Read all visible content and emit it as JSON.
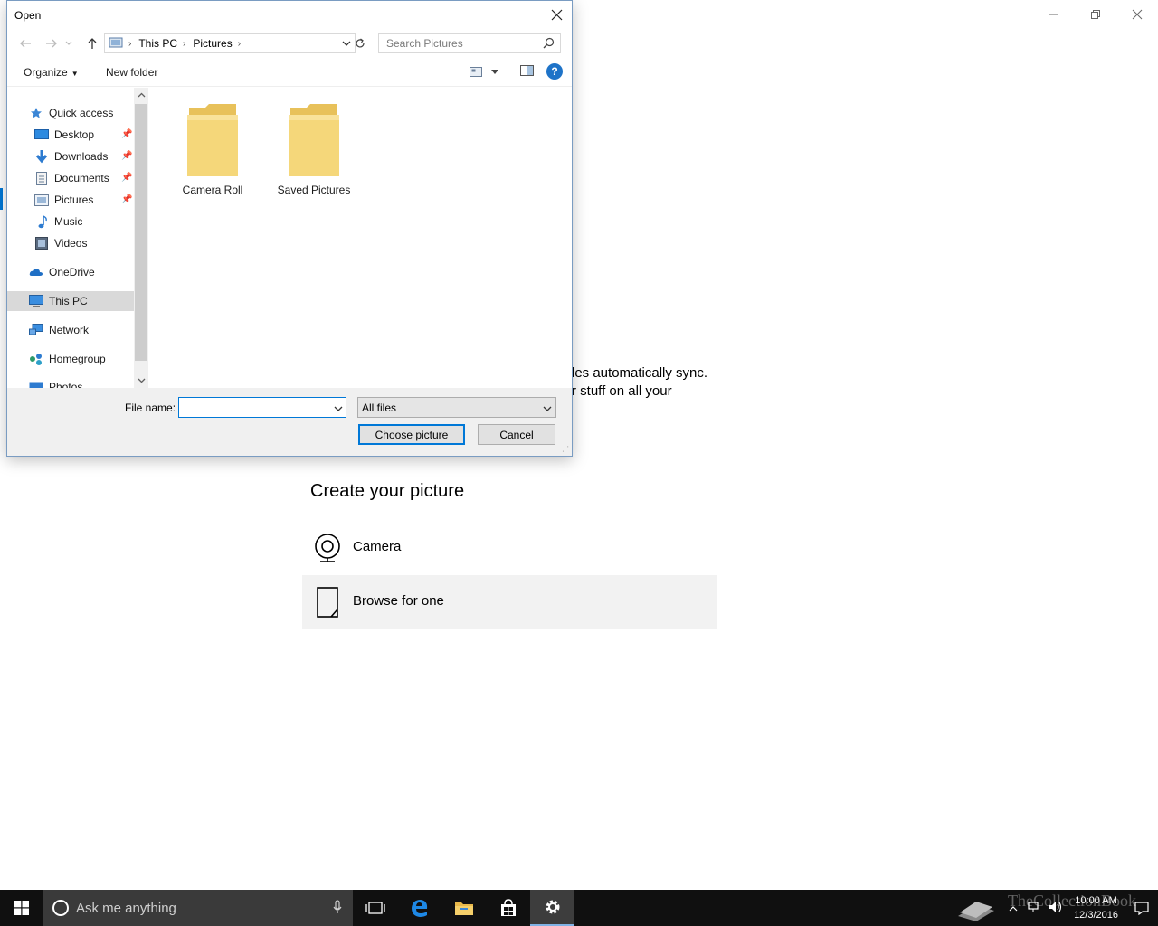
{
  "dialog": {
    "title": "Open",
    "address": {
      "crumbs": [
        "This PC",
        "Pictures"
      ]
    },
    "search_placeholder": "Search Pictures",
    "toolbar": {
      "organize": "Organize",
      "new_folder": "New folder",
      "help": "?"
    },
    "nav": {
      "quick_access": "Quick access",
      "desktop": "Desktop",
      "downloads": "Downloads",
      "documents": "Documents",
      "pictures": "Pictures",
      "music": "Music",
      "videos": "Videos",
      "onedrive": "OneDrive",
      "this_pc": "This PC",
      "network": "Network",
      "homegroup": "Homegroup",
      "photos": "Photos"
    },
    "folders": [
      "Camera Roll",
      "Saved Pictures"
    ],
    "file_name_label": "File name:",
    "file_name_value": "",
    "file_type": "All files",
    "choose_button": "Choose picture",
    "cancel_button": "Cancel"
  },
  "background": {
    "sync_line1": "les automatically sync.",
    "sync_line2": "r stuff on all your",
    "create_heading": "Create your picture",
    "camera_label": "Camera",
    "browse_label": "Browse for one"
  },
  "taskbar": {
    "search_placeholder": "Ask me anything",
    "time": "10:00 AM",
    "date": "12/3/2016",
    "watermark": "TheCollectionBook"
  },
  "colors": {
    "accent": "#0078d7",
    "taskbar": "#101010",
    "folder": "#f5d77a",
    "selected_nav": "#d9d9d9"
  }
}
